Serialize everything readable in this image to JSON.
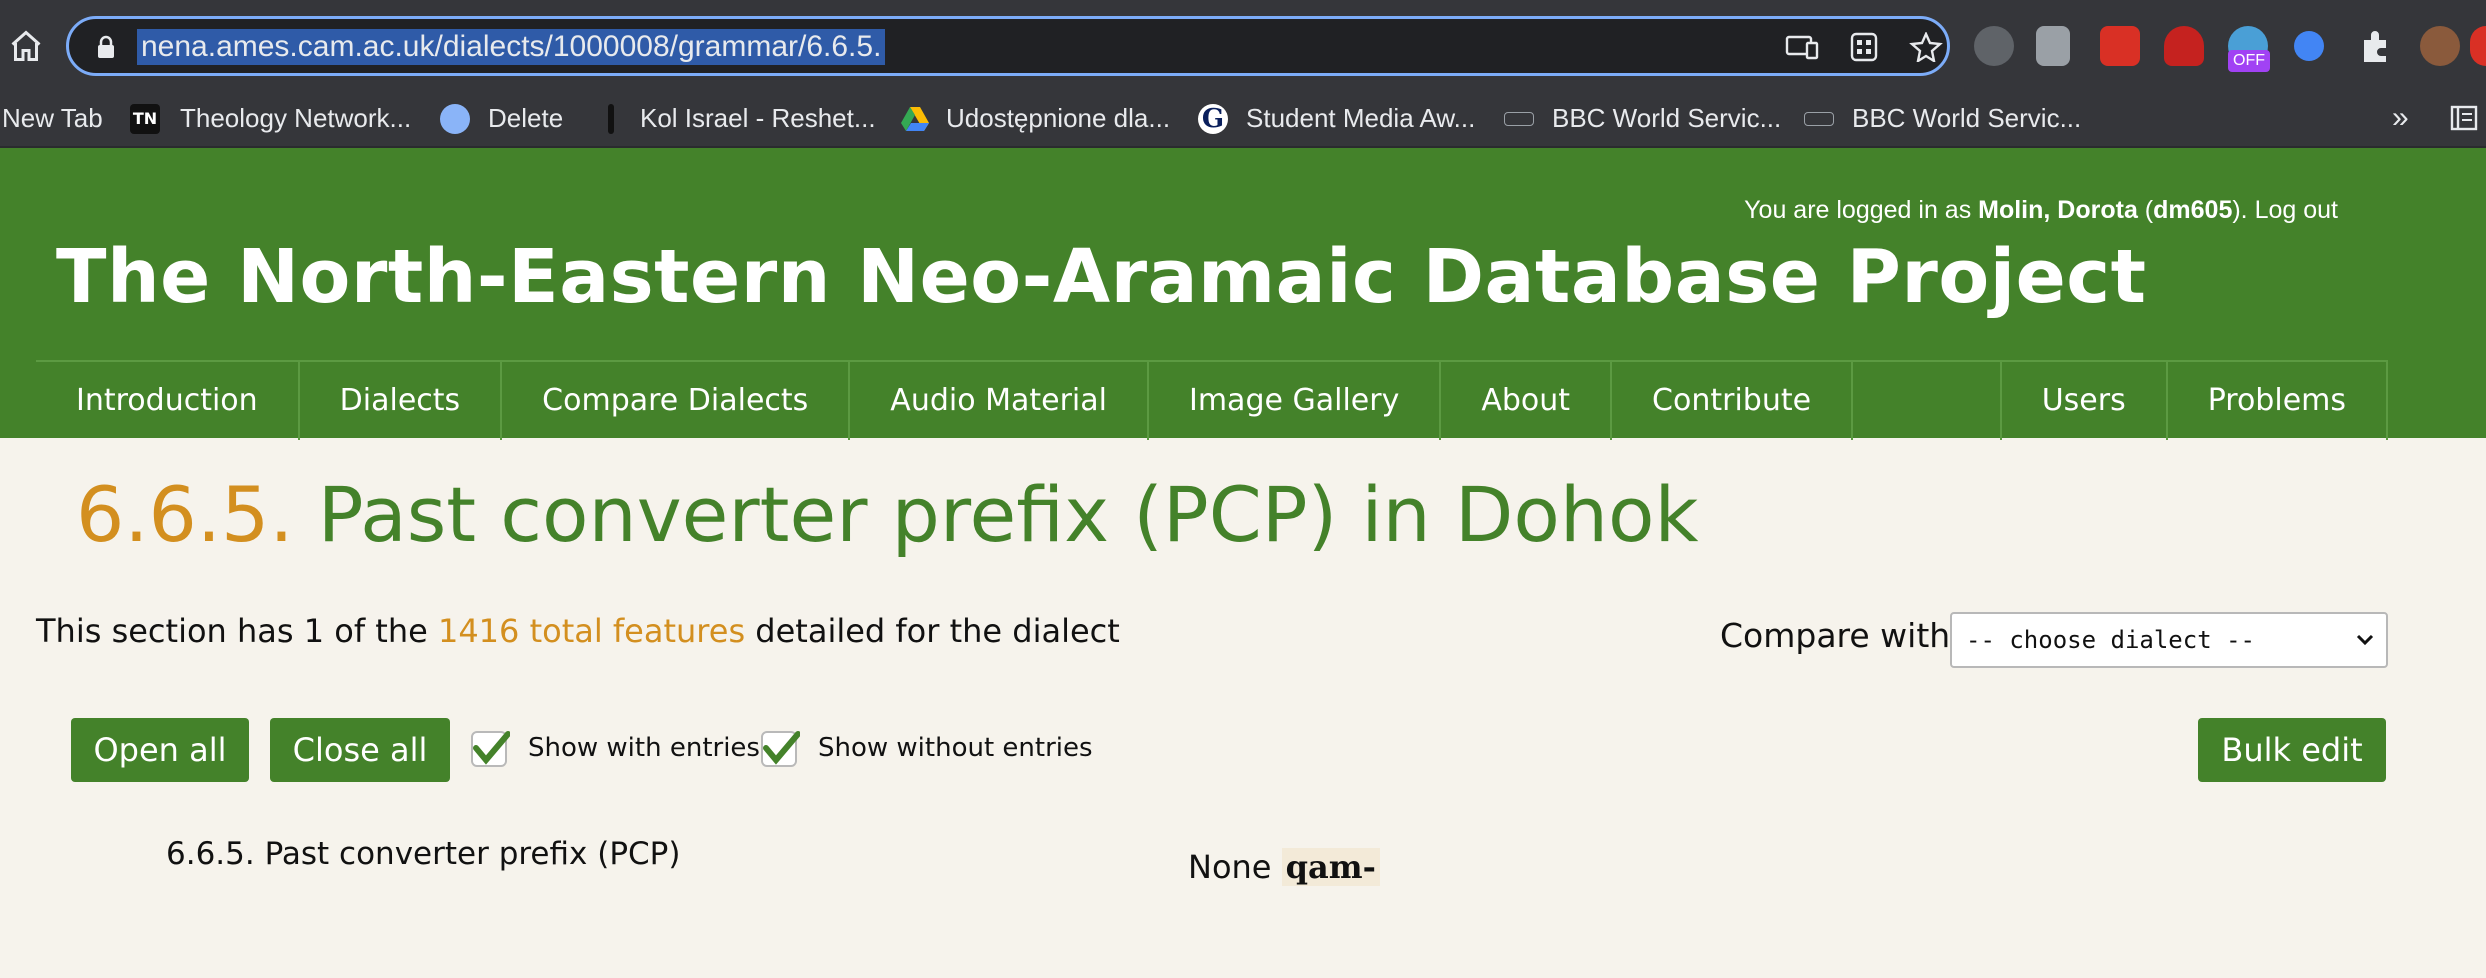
{
  "browser": {
    "url": "nena.ames.cam.ac.uk/dialects/1000008/grammar/6.6.5.",
    "bookmarks": [
      {
        "label": "New Tab",
        "icon": "none"
      },
      {
        "label": "Theology Network...",
        "icon": "tn-logo-icon"
      },
      {
        "label": "Delete",
        "icon": "blue-blob-icon"
      },
      {
        "label": "Kol Israel - Reshet...",
        "icon": "black-bar-icon"
      },
      {
        "label": "Udostępnione dla...",
        "icon": "google-drive-icon"
      },
      {
        "label": "Student Media Aw...",
        "icon": "guardian-g-icon"
      },
      {
        "label": "BBC World Servic...",
        "icon": "bbc-icon"
      },
      {
        "label": "BBC World Servic...",
        "icon": "bbc-icon"
      }
    ],
    "more_bookmarks": "»",
    "ext_off_badge": "OFF",
    "tn_badge": "TN"
  },
  "header": {
    "login_prefix": "You are logged in as ",
    "login_name": "Molin, Dorota",
    "login_open": " (",
    "login_user": "dm605",
    "login_close": "). ",
    "logout": "Log out",
    "title": "The North-Eastern Neo-Aramaic Database Project"
  },
  "nav": {
    "left": [
      "Introduction",
      "Dialects",
      "Compare Dialects",
      "Audio Material",
      "Image Gallery",
      "About",
      "Contribute"
    ],
    "right": [
      "Users",
      "Problems"
    ]
  },
  "page": {
    "title_number": "6.6.5.",
    "title_text": " Past converter prefix (PCP) in Dohok",
    "info_prefix": "This section has 1 of the ",
    "info_link": "1416 total features",
    "info_suffix": " detailed for the dialect",
    "compare_label": "Compare with",
    "compare_selected": "-- choose dialect --"
  },
  "controls": {
    "open_all": "Open all",
    "close_all": "Close all",
    "show_with": "Show with entries",
    "show_without": "Show without entries",
    "bulk_edit": "Bulk edit"
  },
  "feature": {
    "title": "6.6.5. Past converter prefix (PCP)",
    "value_prefix": "None ",
    "value_entry": "qam-"
  },
  "colors": {
    "brand_green": "#44822a",
    "accent_orange": "#d38f1f",
    "page_bg": "#f6f3ec"
  }
}
